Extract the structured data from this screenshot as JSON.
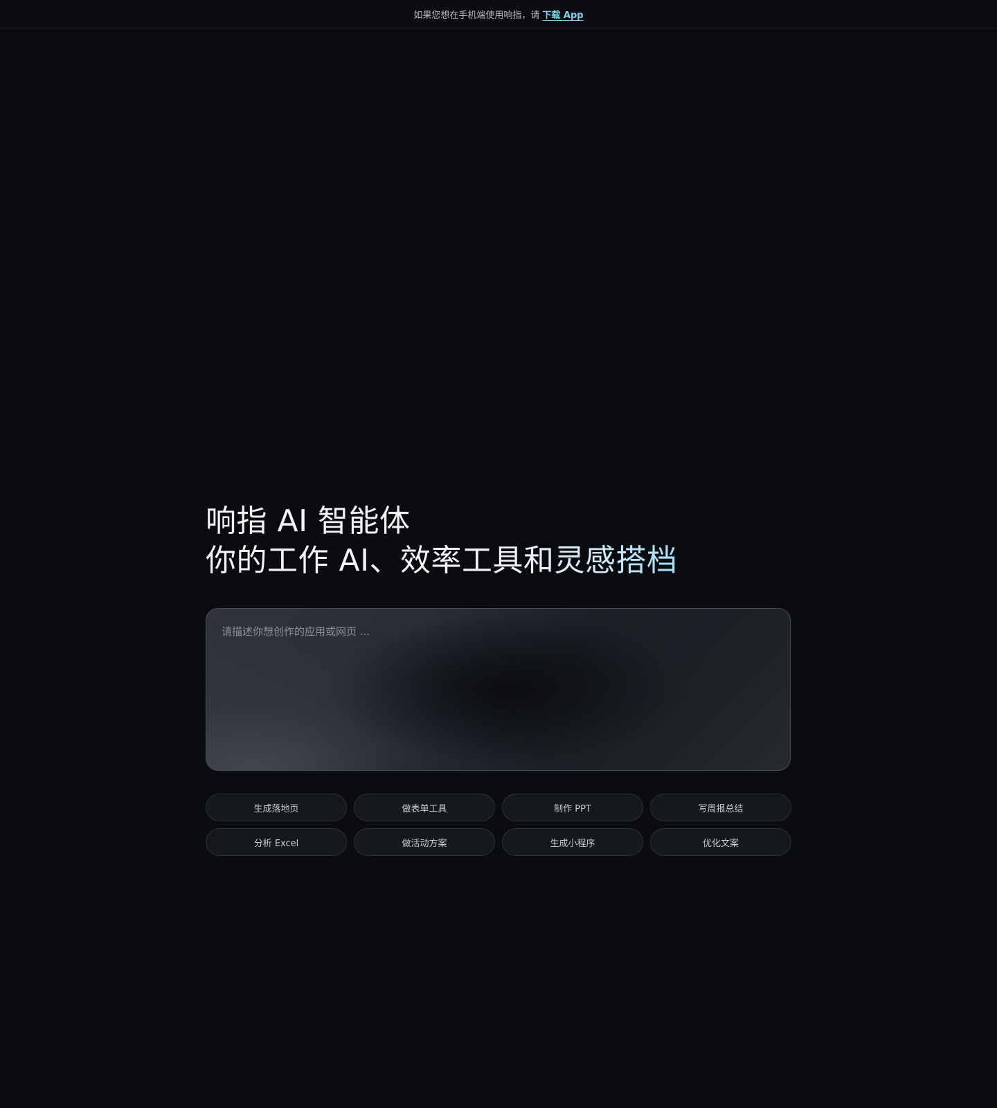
{
  "banner": {
    "text": "如果您想在手机端使用响指，请",
    "link_label": "下载 App"
  },
  "hero": {
    "title_line1": "响指 AI 智能体",
    "title_line2": "你的工作 AI、效率工具和灵感搭档"
  },
  "prompt": {
    "placeholder": "请描述你想创作的应用或网页 ..."
  },
  "suggestions": [
    "生成落地页",
    "做表单工具",
    "制作 PPT",
    "写周报总结",
    "分析 Excel",
    "做活动方案",
    "生成小程序",
    "优化文案"
  ],
  "colors": {
    "background": "#0a0c10",
    "link": "#7dd3f0",
    "accent_gradient_end": "#9fdcf5"
  }
}
